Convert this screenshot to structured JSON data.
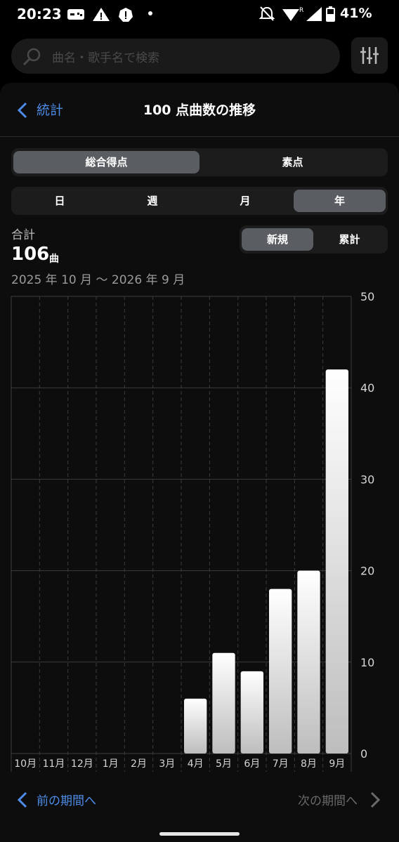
{
  "status": {
    "time": "20:23",
    "battery": "41%"
  },
  "search": {
    "placeholder": "曲名・歌手名で検索"
  },
  "header": {
    "back_label": "統計",
    "title": "100 点曲数の推移"
  },
  "score_toggle": {
    "options": [
      "総合得点",
      "素点"
    ],
    "selected": 0
  },
  "period_toggle": {
    "options": [
      "日",
      "週",
      "月",
      "年"
    ],
    "selected": 3
  },
  "mode_toggle": {
    "options": [
      "新規",
      "累計"
    ],
    "selected": 0
  },
  "summary": {
    "label": "合計",
    "count": "106",
    "unit": "曲",
    "range": "2025 年 10 月 〜 2026 年 9 月"
  },
  "chart_data": {
    "type": "bar",
    "categories": [
      "10月",
      "11月",
      "12月",
      "1月",
      "2月",
      "3月",
      "4月",
      "5月",
      "6月",
      "7月",
      "8月",
      "9月"
    ],
    "values": [
      0,
      0,
      0,
      0,
      0,
      0,
      6,
      11,
      9,
      18,
      20,
      42
    ],
    "ylim": [
      0,
      50
    ],
    "yticks": [
      0,
      10,
      20,
      30,
      40,
      50
    ],
    "grid": true
  },
  "nav": {
    "prev_label": "前の期間へ",
    "next_label": "次の期間へ"
  }
}
